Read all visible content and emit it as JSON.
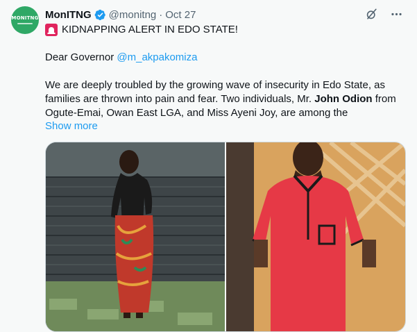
{
  "author": {
    "avatar_text": "MONITNG",
    "name": "MonITNG",
    "handle": "@monitng",
    "separator": "·",
    "time": "Oct 27"
  },
  "tweet": {
    "alert_title": "KIDNAPPING ALERT IN EDO STATE!",
    "greeting_prefix": "Dear Governor ",
    "greeting_mention": "@m_akpakomiza",
    "body_part1": "We are deeply troubled by the growing wave of insecurity in Edo State, as families are thrown into pain and fear. Two individuals, Mr. ",
    "body_bold": "John Odion",
    "body_part2": " from Ogute-Emai, Owan East LGA, and Miss Ayeni Joy, are among the",
    "show_more": "Show more"
  },
  "icons": {
    "verified": "verified-badge-icon",
    "grok": "grok-icon",
    "more": "more-options-icon",
    "siren": "siren-icon"
  },
  "colors": {
    "accent": "#1d9bf0",
    "avatar_bg": "#2fa866",
    "text": "#0f1419",
    "muted": "#536471",
    "background": "#f7f9f9"
  },
  "media": {
    "images": [
      "photo-woman-standing",
      "photo-man-red-shirt"
    ]
  }
}
